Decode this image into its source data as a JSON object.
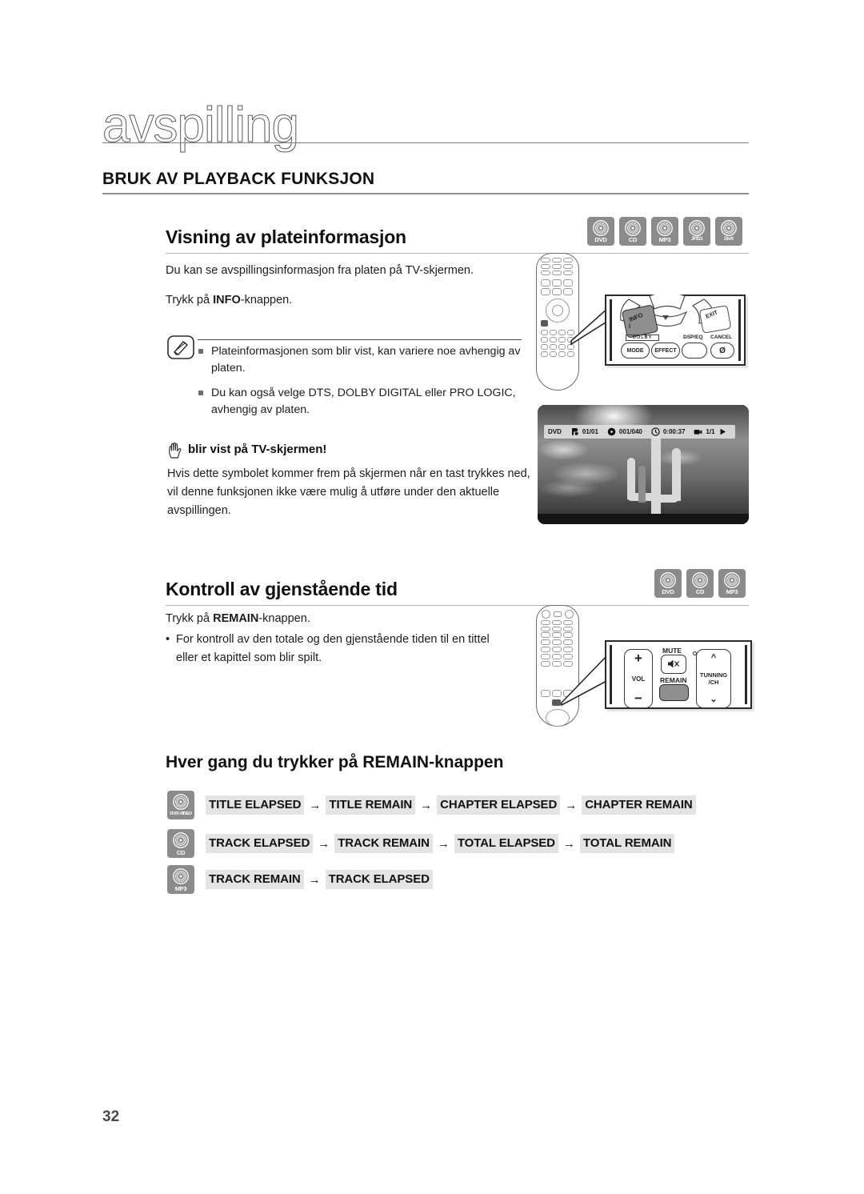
{
  "page": {
    "chapter_title": "avspilling",
    "section_title": "BRUK AV PLAYBACK FUNKSJON",
    "page_number": "32"
  },
  "section_disc_info": {
    "heading": "Visning av plateinformasjon",
    "badges": [
      {
        "label": "DVD",
        "icon": "disc-icon"
      },
      {
        "label": "CD",
        "icon": "disc-icon"
      },
      {
        "label": "MP3",
        "icon": "disc-icon"
      },
      {
        "label": "JPEG",
        "icon": "disc-icon"
      },
      {
        "label": "DivX",
        "icon": "disc-icon"
      }
    ],
    "intro": "Du kan se avspillingsinformasjon fra platen på TV-skjermen.",
    "instruction_prefix": "Trykk på ",
    "instruction_bold": "INFO",
    "instruction_suffix": "-knappen.",
    "note_icon": "note-pencil-icon",
    "notes": [
      "Plateinformasjonen som blir vist, kan variere noe avhengig av platen.",
      "Du kan også velge DTS, DOLBY DIGITAL eller PRO LOGIC, avhengig av platen."
    ],
    "caution_icon": "hand-stop-icon",
    "caution_title": "blir vist på TV-skjermen!",
    "caution_body": "Hvis dette symbolet kommer frem på skjermen når en tast trykkes ned, vil denne funksjonen ikke være mulig å utføre under den aktuelle avspillingen."
  },
  "figure_info_remote": {
    "info_button_label": "INFO",
    "info_button_sub": "i",
    "exit_button_label": "EXIT",
    "dolby_label": "DOLBY",
    "mode_label": "MODE",
    "effect_label": "EFFECT",
    "dsp_eq_label": "DSP/EQ",
    "cancel_label": "CANCEL",
    "cancel_glyph": "Ø"
  },
  "tv_screen": {
    "osd": {
      "media": "DVD",
      "title_icon": "title-icon",
      "title_value": "01/01",
      "chapter_icon": "chapter-disc-icon",
      "chapter_value": "001/040",
      "time_icon": "clock-icon",
      "time_value": "0:00:37",
      "angle_icon": "camera-icon",
      "angle_value": "1/1",
      "play_icon": "play-icon"
    }
  },
  "section_remain": {
    "heading": "Kontroll av gjenstående tid",
    "badges": [
      {
        "label": "DVD",
        "icon": "disc-icon"
      },
      {
        "label": "CD",
        "icon": "disc-icon"
      },
      {
        "label": "MP3",
        "icon": "disc-icon"
      }
    ],
    "instruction_prefix": "Trykk på ",
    "instruction_bold": "REMAIN",
    "instruction_suffix": "-knappen.",
    "bullets": [
      "For kontroll av den totale og den gjenstående tiden til en tittel eller et kapittel som blir spilt."
    ]
  },
  "figure_remain_remote": {
    "vol_label": "VOL",
    "vol_plus": "+",
    "vol_minus": "−",
    "mute_label": "MUTE",
    "mute_icon": "mute-speaker-icon",
    "remain_label": "REMAIN",
    "tunning_label": "TUNNING",
    "tunning_sub": "/CH",
    "up_icon": "chevron-up-icon",
    "down_icon": "chevron-down-icon"
  },
  "flow": {
    "heading": "Hver gang du trykker på REMAIN-knappen",
    "arrow": "→",
    "rows": [
      {
        "badge_label": "DVD-VIDEO",
        "badge_icon": "disc-icon",
        "steps": [
          "TITLE ELAPSED",
          "TITLE REMAIN",
          "CHAPTER ELAPSED",
          "CHAPTER REMAIN"
        ]
      },
      {
        "badge_label": "CD",
        "badge_icon": "disc-icon",
        "steps": [
          "TRACK ELAPSED",
          "TRACK REMAIN",
          "TOTAL ELAPSED",
          "TOTAL REMAIN"
        ]
      },
      {
        "badge_label": "MP3",
        "badge_icon": "disc-icon",
        "steps": [
          "TRACK REMAIN",
          "TRACK ELAPSED"
        ]
      }
    ]
  },
  "colors": {
    "badge_gray": "#8b8b8b",
    "chip_gray": "#e4e4e4",
    "rule_gray": "#8d8d8d",
    "text": "#1c1c1c"
  }
}
